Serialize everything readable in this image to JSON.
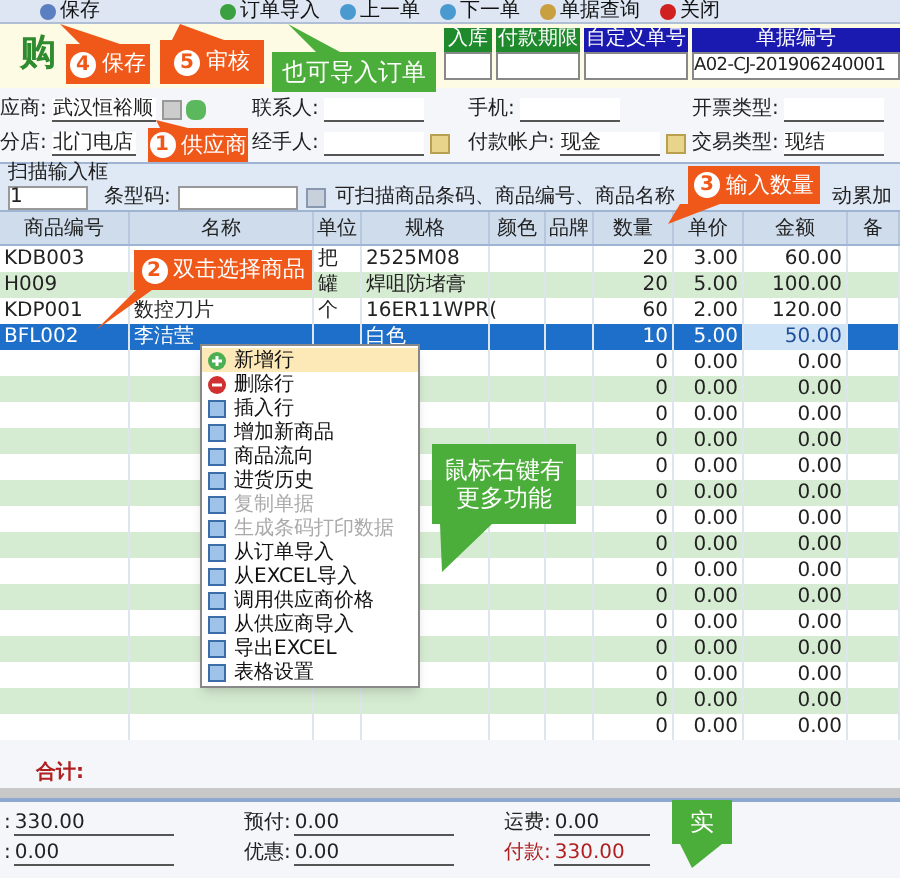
{
  "toolbar": {
    "buttons": [
      {
        "label": "保存",
        "disabled": false
      },
      {
        "label": "订单导入",
        "disabled": false
      },
      {
        "label": "上一单",
        "disabled": false
      },
      {
        "label": "下一单",
        "disabled": false
      },
      {
        "label": "单据查询",
        "disabled": false
      },
      {
        "label": "关闭",
        "disabled": false
      }
    ]
  },
  "title": "购",
  "header_fields": [
    {
      "label": "入库",
      "color": "#1f8a2c"
    },
    {
      "label": "付款期限",
      "color": "#1f8a2c"
    },
    {
      "label": "自定义单号",
      "color": "#1a1ab0"
    },
    {
      "label": "单据编号",
      "value": "A02-CJ-201906240001",
      "color": "#1a1ab0"
    }
  ],
  "form_rows": [
    [
      {
        "label": "应商:",
        "value": "武汉恒裕顺",
        "buttons": true
      },
      {
        "label": "联系人:"
      },
      {
        "label": "手机:"
      },
      {
        "label": "开票类型:"
      }
    ],
    [
      {
        "label": "分店:",
        "value": "北门电店"
      },
      {
        "label": "经手人:",
        "lookup": true
      },
      {
        "label": "付款帐户:",
        "value": "现金",
        "lookup": true
      },
      {
        "label": "交易类型:",
        "value": "现结"
      }
    ]
  ],
  "scan": {
    "legend": "扫描输入框",
    "count": "1",
    "barcode_label": "条型码:",
    "hint_start": "可扫描商品条码、商品编号、商品名称",
    "hint_end": "动累加"
  },
  "table": {
    "columns": [
      "商品编号",
      "名称",
      "单位",
      "规格",
      "颜色",
      "品牌",
      "数量",
      "单价",
      "金额",
      "备"
    ],
    "rows": [
      {
        "selected": false,
        "cells": [
          "KDB003",
          "",
          "把",
          "2525M08",
          "",
          "",
          "20",
          "3.00",
          "60.00",
          ""
        ]
      },
      {
        "selected": false,
        "cells": [
          "H009",
          "",
          "罐",
          "焊咀防堵膏",
          "",
          "",
          "20",
          "5.00",
          "100.00",
          ""
        ]
      },
      {
        "selected": false,
        "cells": [
          "KDP001",
          "数控刀片",
          "个",
          "16ER11WPR(",
          "",
          "",
          "60",
          "2.00",
          "120.00",
          ""
        ]
      },
      {
        "selected": true,
        "cells": [
          "BFL002",
          "李洁莹",
          "",
          "白色",
          "",
          "",
          "10",
          "5.00",
          "50.00",
          ""
        ]
      },
      {
        "selected": false,
        "cells": [
          "",
          "",
          "",
          "",
          "",
          "",
          "0",
          "0.00",
          "0.00",
          ""
        ]
      },
      {
        "selected": false,
        "cells": [
          "",
          "",
          "",
          "",
          "",
          "",
          "0",
          "0.00",
          "0.00",
          ""
        ]
      },
      {
        "selected": false,
        "cells": [
          "",
          "",
          "",
          "",
          "",
          "",
          "0",
          "0.00",
          "0.00",
          ""
        ]
      },
      {
        "selected": false,
        "cells": [
          "",
          "",
          "",
          "",
          "",
          "",
          "0",
          "0.00",
          "0.00",
          ""
        ]
      },
      {
        "selected": false,
        "cells": [
          "",
          "",
          "",
          "",
          "",
          "",
          "0",
          "0.00",
          "0.00",
          ""
        ]
      },
      {
        "selected": false,
        "cells": [
          "",
          "",
          "",
          "",
          "",
          "",
          "0",
          "0.00",
          "0.00",
          ""
        ]
      },
      {
        "selected": false,
        "cells": [
          "",
          "",
          "",
          "",
          "",
          "",
          "0",
          "0.00",
          "0.00",
          ""
        ]
      },
      {
        "selected": false,
        "cells": [
          "",
          "",
          "",
          "",
          "",
          "",
          "0",
          "0.00",
          "0.00",
          ""
        ]
      },
      {
        "selected": false,
        "cells": [
          "",
          "",
          "",
          "",
          "",
          "",
          "0",
          "0.00",
          "0.00",
          ""
        ]
      },
      {
        "selected": false,
        "cells": [
          "",
          "",
          "",
          "",
          "",
          "",
          "0",
          "0.00",
          "0.00",
          ""
        ]
      },
      {
        "selected": false,
        "cells": [
          "",
          "",
          "",
          "",
          "",
          "",
          "0",
          "0.00",
          "0.00",
          ""
        ]
      },
      {
        "selected": false,
        "cells": [
          "",
          "",
          "",
          "",
          "",
          "",
          "0",
          "0.00",
          "0.00",
          ""
        ]
      },
      {
        "selected": false,
        "cells": [
          "",
          "",
          "",
          "",
          "",
          "",
          "0",
          "0.00",
          "0.00",
          ""
        ]
      },
      {
        "selected": false,
        "cells": [
          "",
          "",
          "",
          "",
          "",
          "",
          "0",
          "0.00",
          "0.00",
          ""
        ]
      },
      {
        "selected": false,
        "cells": [
          "",
          "",
          "",
          "",
          "",
          "",
          "0",
          "0.00",
          "0.00",
          ""
        ]
      }
    ]
  },
  "context_menu": [
    {
      "label": "新增行",
      "disabled": false,
      "selected": true
    },
    {
      "label": "删除行",
      "disabled": false,
      "selected": false
    },
    {
      "label": "插入行",
      "disabled": false,
      "selected": false
    },
    {
      "label": "增加新商品",
      "disabled": false,
      "selected": false
    },
    {
      "label": "商品流向",
      "disabled": false,
      "selected": false
    },
    {
      "label": "进货历史",
      "disabled": false,
      "selected": false
    },
    {
      "label": "复制单据",
      "disabled": true,
      "selected": false
    },
    {
      "label": "生成条码打印数据",
      "disabled": true,
      "selected": false
    },
    {
      "label": "从订单导入",
      "disabled": false,
      "selected": false
    },
    {
      "label": "从EXCEL导入",
      "disabled": false,
      "selected": false
    },
    {
      "label": "调用供应商价格",
      "disabled": false,
      "selected": false
    },
    {
      "label": "从供应商导入",
      "disabled": false,
      "selected": false
    },
    {
      "label": "导出EXCEL",
      "disabled": false,
      "selected": false
    },
    {
      "label": "表格设置",
      "disabled": false,
      "selected": false
    }
  ],
  "total_label": "合计:",
  "footer_rows": [
    [
      {
        "label": ":",
        "value": "330.00",
        "highlight": false
      },
      {
        "label": "预付:",
        "value": "0.00",
        "highlight": false
      },
      {
        "label": "运费:",
        "value": "0.00",
        "highlight": false
      }
    ],
    [
      {
        "label": ":",
        "value": "0.00",
        "highlight": false
      },
      {
        "label": "优惠:",
        "value": "0.00",
        "highlight": false
      },
      {
        "label": "付款:",
        "value": "330.00",
        "highlight": true
      }
    ]
  ],
  "annotations": [
    {
      "kind": "step",
      "number": "4",
      "text": "保存"
    },
    {
      "kind": "step",
      "number": "5",
      "text": "审核"
    },
    {
      "kind": "note",
      "text": "也可导入订单"
    },
    {
      "kind": "step",
      "number": "1",
      "text": "供应商"
    },
    {
      "kind": "step",
      "number": "2",
      "text": "双击选择商品"
    },
    {
      "kind": "step",
      "number": "3",
      "text": "输入数量"
    },
    {
      "kind": "note",
      "text": "鼠标右键有更多功能"
    },
    {
      "kind": "note",
      "text": "实"
    }
  ]
}
